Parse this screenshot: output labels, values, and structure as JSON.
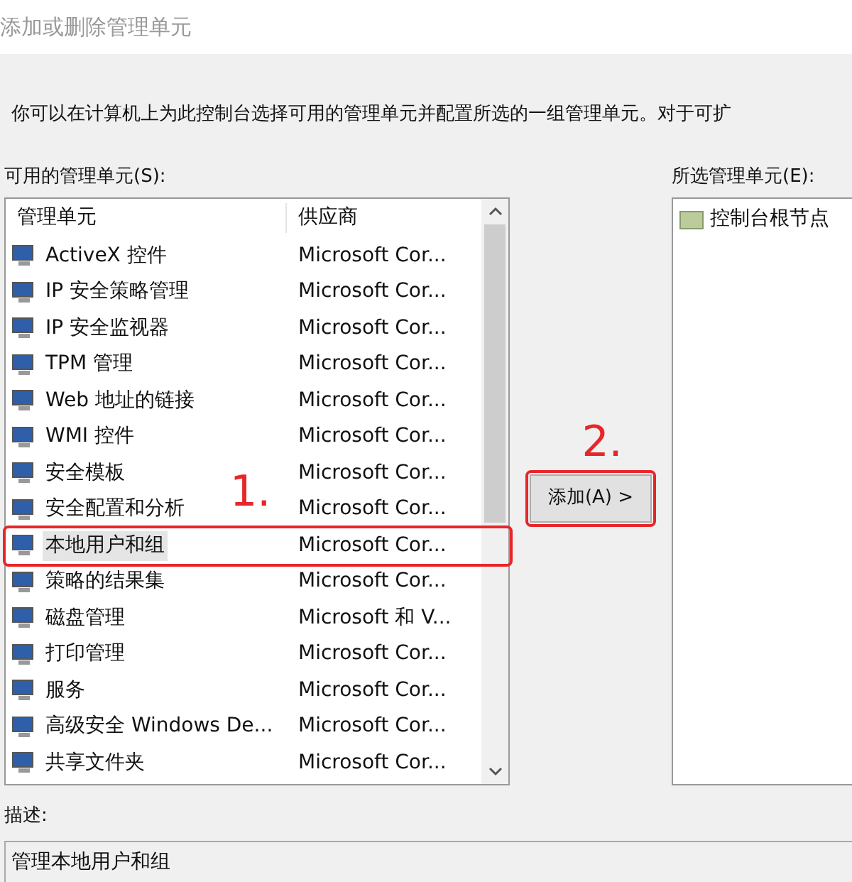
{
  "window": {
    "title": "添加或删除管理单元"
  },
  "intro": "你可以在计算机上为此控制台选择可用的管理单元并配置所选的一组管理单元。对于可扩",
  "available": {
    "label": "可用的管理单元(S):",
    "columns": [
      "管理单元",
      "供应商"
    ],
    "rows": [
      {
        "name": "ActiveX 控件",
        "vendor": "Microsoft Cor...",
        "selected": false
      },
      {
        "name": "IP 安全策略管理",
        "vendor": "Microsoft Cor...",
        "selected": false
      },
      {
        "name": "IP 安全监视器",
        "vendor": "Microsoft Cor...",
        "selected": false
      },
      {
        "name": "TPM 管理",
        "vendor": "Microsoft Cor...",
        "selected": false
      },
      {
        "name": "Web 地址的链接",
        "vendor": "Microsoft Cor...",
        "selected": false
      },
      {
        "name": "WMI 控件",
        "vendor": "Microsoft Cor...",
        "selected": false
      },
      {
        "name": "安全模板",
        "vendor": "Microsoft Cor...",
        "selected": false
      },
      {
        "name": "安全配置和分析",
        "vendor": "Microsoft Cor...",
        "selected": false
      },
      {
        "name": "本地用户和组",
        "vendor": "Microsoft Cor...",
        "selected": true
      },
      {
        "name": "策略的结果集",
        "vendor": "Microsoft Cor...",
        "selected": false
      },
      {
        "name": "磁盘管理",
        "vendor": "Microsoft 和 V...",
        "selected": false
      },
      {
        "name": "打印管理",
        "vendor": "Microsoft Cor...",
        "selected": false
      },
      {
        "name": "服务",
        "vendor": "Microsoft Cor...",
        "selected": false
      },
      {
        "name": "高级安全 Windows De...",
        "vendor": "Microsoft Cor...",
        "selected": false
      },
      {
        "name": "共享文件夹",
        "vendor": "Microsoft Cor...",
        "selected": false
      }
    ]
  },
  "add_button": "添加(A) >",
  "selected_panel": {
    "label": "所选管理单元(E):",
    "items": [
      "控制台根节点"
    ]
  },
  "description": {
    "label": "描述:",
    "text": "管理本地用户和组"
  },
  "annotations": [
    "1.",
    "2."
  ]
}
